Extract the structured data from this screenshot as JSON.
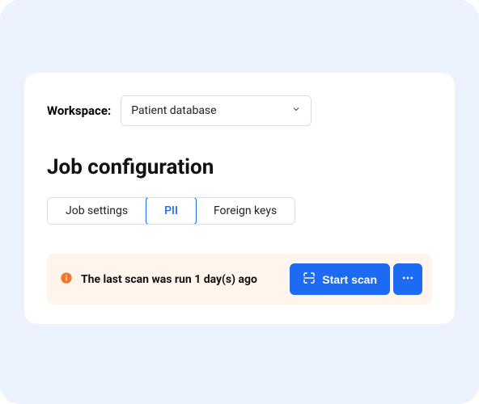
{
  "workspace": {
    "label": "Workspace:",
    "selected": "Patient database"
  },
  "title": "Job configuration",
  "tabs": {
    "job_settings": "Job settings",
    "pii": "PII",
    "foreign_keys": "Foreign keys"
  },
  "banner": {
    "text": "The last scan was run 1 day(s) ago",
    "start_scan": "Start scan"
  }
}
